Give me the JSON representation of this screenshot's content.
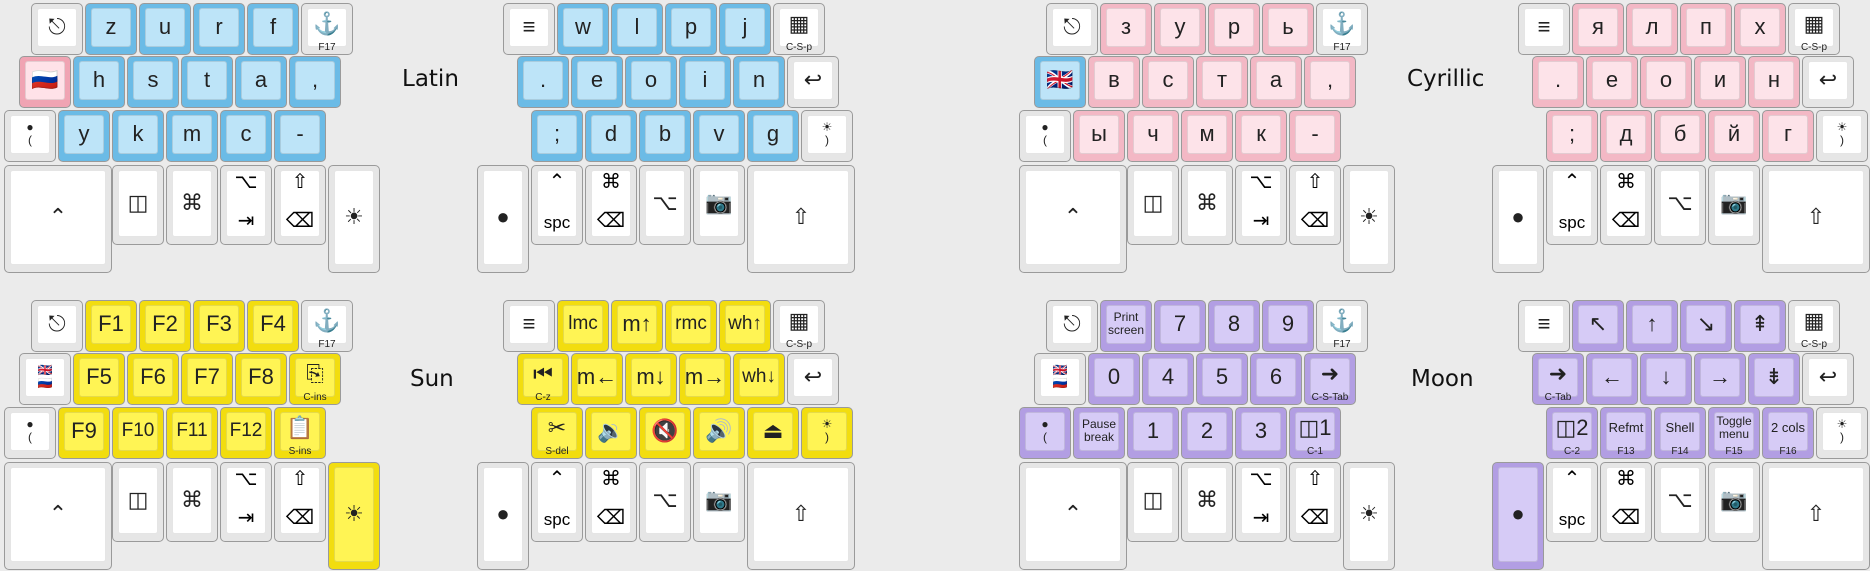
{
  "colors": {
    "blue": "#6bbbe6",
    "pink": "#f3b8c5",
    "yellow": "#f2dd0f",
    "purple": "#b29ee3",
    "white": "#e6e6e6"
  },
  "icon_legend": {
    "⎋": "escape",
    "⚓": "anchor",
    "≡": "menu",
    "▦": "app-switcher",
    "↩": "enter",
    "⌃": "control",
    "◫": "dual-panel",
    "⌘": "command",
    "⌥": "option",
    "⇥": "tab",
    "⇧": "shift",
    "⌫": "backspace",
    "☀": "sun",
    "●": "moon",
    "📷": "camera"
  },
  "layers": [
    {
      "name": "latin",
      "title": "Latin",
      "keys": [
        {
          "id": "0",
          "label": "⎋",
          "color": "white"
        },
        {
          "id": "1",
          "label": "z",
          "color": "blue"
        },
        {
          "id": "2",
          "label": "u",
          "color": "blue"
        },
        {
          "id": "3",
          "label": "r",
          "color": "blue"
        },
        {
          "id": "4",
          "label": "f",
          "color": "blue"
        },
        {
          "id": "5",
          "label": "⚓",
          "sub": "F17",
          "color": "white"
        },
        {
          "id": "6",
          "label": "🇷🇺",
          "color": "red"
        },
        {
          "id": "7",
          "label": "h",
          "color": "blue"
        },
        {
          "id": "8",
          "label": "s",
          "color": "blue"
        },
        {
          "id": "9",
          "label": "t",
          "color": "blue"
        },
        {
          "id": "10",
          "label": "a",
          "color": "blue"
        },
        {
          "id": "11",
          "label": ",",
          "color": "blue"
        },
        {
          "id": "12",
          "label": "●\n(",
          "color": "white"
        },
        {
          "id": "13",
          "label": "y",
          "color": "blue"
        },
        {
          "id": "14",
          "label": "k",
          "color": "blue"
        },
        {
          "id": "15",
          "label": "m",
          "color": "blue"
        },
        {
          "id": "16",
          "label": "c",
          "color": "blue"
        },
        {
          "id": "17",
          "label": "-",
          "color": "blue"
        },
        {
          "id": "18",
          "label": "⌃",
          "color": "white"
        },
        {
          "id": "19",
          "label": "◫",
          "color": "white"
        },
        {
          "id": "20",
          "label": "⌘",
          "color": "white"
        },
        {
          "id": "21",
          "tap": "⌥",
          "hold": "⇥",
          "color": "white"
        },
        {
          "id": "22",
          "tap": "⇧",
          "hold": "⌫",
          "color": "white"
        },
        {
          "id": "23",
          "label": "☀",
          "color": "white"
        },
        {
          "id": "24",
          "label": "≡",
          "color": "white"
        },
        {
          "id": "25",
          "label": "w",
          "color": "blue"
        },
        {
          "id": "26",
          "label": "l",
          "color": "blue"
        },
        {
          "id": "27",
          "label": "p",
          "color": "blue"
        },
        {
          "id": "28",
          "label": "j",
          "color": "blue"
        },
        {
          "id": "29",
          "label": "▦",
          "sub": "C-S-p",
          "color": "white"
        },
        {
          "id": "30",
          "label": ".",
          "color": "blue"
        },
        {
          "id": "31",
          "label": "e",
          "color": "blue"
        },
        {
          "id": "32",
          "label": "o",
          "color": "blue"
        },
        {
          "id": "33",
          "label": "i",
          "color": "blue"
        },
        {
          "id": "34",
          "label": "n",
          "color": "blue"
        },
        {
          "id": "35",
          "label": "↩",
          "color": "white"
        },
        {
          "id": "36",
          "label": ";",
          "color": "blue"
        },
        {
          "id": "37",
          "label": "d",
          "color": "blue"
        },
        {
          "id": "38",
          "label": "b",
          "color": "blue"
        },
        {
          "id": "39",
          "label": "v",
          "color": "blue"
        },
        {
          "id": "40",
          "label": "g",
          "color": "blue"
        },
        {
          "id": "41",
          "label": "☀\n)",
          "color": "white"
        },
        {
          "id": "42",
          "label": "●",
          "color": "white"
        },
        {
          "id": "43",
          "tap": "⌃",
          "hold": "spc",
          "color": "white"
        },
        {
          "id": "44",
          "tap": "⌘",
          "hold": "⌫",
          "color": "white"
        },
        {
          "id": "45",
          "label": "⌥",
          "color": "white"
        },
        {
          "id": "46",
          "label": "📷",
          "color": "white"
        },
        {
          "id": "47",
          "label": "⇧",
          "color": "white"
        }
      ]
    },
    {
      "name": "cyrillic",
      "title": "Cyrillic",
      "keys": [
        {
          "id": "0",
          "label": "⎋",
          "color": "white"
        },
        {
          "id": "1",
          "label": "з",
          "color": "pink"
        },
        {
          "id": "2",
          "label": "у",
          "color": "pink"
        },
        {
          "id": "3",
          "label": "р",
          "color": "pink"
        },
        {
          "id": "4",
          "label": "ь",
          "color": "pink"
        },
        {
          "id": "5",
          "label": "⚓",
          "sub": "F17",
          "color": "white"
        },
        {
          "id": "6",
          "label": "🇬🇧",
          "color": "blue"
        },
        {
          "id": "7",
          "label": "в",
          "color": "pink"
        },
        {
          "id": "8",
          "label": "с",
          "color": "pink"
        },
        {
          "id": "9",
          "label": "т",
          "color": "pink"
        },
        {
          "id": "10",
          "label": "а",
          "color": "pink"
        },
        {
          "id": "11",
          "label": ",",
          "color": "pink"
        },
        {
          "id": "12",
          "label": "●\n(",
          "color": "white"
        },
        {
          "id": "13",
          "label": "ы",
          "color": "pink"
        },
        {
          "id": "14",
          "label": "ч",
          "color": "pink"
        },
        {
          "id": "15",
          "label": "м",
          "color": "pink"
        },
        {
          "id": "16",
          "label": "к",
          "color": "pink"
        },
        {
          "id": "17",
          "label": "-",
          "color": "pink"
        },
        {
          "id": "18",
          "label": "⌃",
          "color": "white"
        },
        {
          "id": "19",
          "label": "◫",
          "color": "white"
        },
        {
          "id": "20",
          "label": "⌘",
          "color": "white"
        },
        {
          "id": "21",
          "tap": "⌥",
          "hold": "⇥",
          "color": "white"
        },
        {
          "id": "22",
          "tap": "⇧",
          "hold": "⌫",
          "color": "white"
        },
        {
          "id": "23",
          "label": "☀",
          "color": "white"
        },
        {
          "id": "24",
          "label": "≡",
          "color": "white"
        },
        {
          "id": "25",
          "label": "я",
          "color": "pink"
        },
        {
          "id": "26",
          "label": "л",
          "color": "pink"
        },
        {
          "id": "27",
          "label": "п",
          "color": "pink"
        },
        {
          "id": "28",
          "label": "х",
          "color": "pink"
        },
        {
          "id": "29",
          "label": "▦",
          "sub": "C-S-p",
          "color": "white"
        },
        {
          "id": "30",
          "label": ".",
          "color": "pink"
        },
        {
          "id": "31",
          "label": "е",
          "color": "pink"
        },
        {
          "id": "32",
          "label": "о",
          "color": "pink"
        },
        {
          "id": "33",
          "label": "и",
          "color": "pink"
        },
        {
          "id": "34",
          "label": "н",
          "color": "pink"
        },
        {
          "id": "35",
          "label": "↩",
          "color": "white"
        },
        {
          "id": "36",
          "label": ";",
          "color": "pink"
        },
        {
          "id": "37",
          "label": "д",
          "color": "pink"
        },
        {
          "id": "38",
          "label": "б",
          "color": "pink"
        },
        {
          "id": "39",
          "label": "й",
          "color": "pink"
        },
        {
          "id": "40",
          "label": "г",
          "color": "pink"
        },
        {
          "id": "41",
          "label": "☀\n)",
          "color": "white"
        },
        {
          "id": "42",
          "label": "●",
          "color": "white"
        },
        {
          "id": "43",
          "tap": "⌃",
          "hold": "spc",
          "color": "white"
        },
        {
          "id": "44",
          "tap": "⌘",
          "hold": "⌫",
          "color": "white"
        },
        {
          "id": "45",
          "label": "⌥",
          "color": "white"
        },
        {
          "id": "46",
          "label": "📷",
          "color": "white"
        },
        {
          "id": "47",
          "label": "⇧",
          "color": "white"
        }
      ]
    },
    {
      "name": "sun",
      "title": "Sun",
      "keys": [
        {
          "id": "0",
          "label": "⎋",
          "color": "white"
        },
        {
          "id": "1",
          "label": "F1",
          "color": "yellow"
        },
        {
          "id": "2",
          "label": "F2",
          "color": "yellow"
        },
        {
          "id": "3",
          "label": "F3",
          "color": "yellow"
        },
        {
          "id": "4",
          "label": "F4",
          "color": "yellow"
        },
        {
          "id": "5",
          "label": "⚓",
          "sub": "F17",
          "color": "white"
        },
        {
          "id": "6",
          "label": "🇬🇧\n🇷🇺",
          "color": "white"
        },
        {
          "id": "7",
          "label": "F5",
          "color": "yellow"
        },
        {
          "id": "8",
          "label": "F6",
          "color": "yellow"
        },
        {
          "id": "9",
          "label": "F7",
          "color": "yellow"
        },
        {
          "id": "10",
          "label": "F8",
          "color": "yellow"
        },
        {
          "id": "11",
          "label": "⎘",
          "sub": "C-ins",
          "color": "yellow"
        },
        {
          "id": "12",
          "label": "●\n(",
          "color": "white"
        },
        {
          "id": "13",
          "label": "F9",
          "color": "yellow"
        },
        {
          "id": "14",
          "label": "F10",
          "color": "yellow"
        },
        {
          "id": "15",
          "label": "F11",
          "color": "yellow"
        },
        {
          "id": "16",
          "label": "F12",
          "color": "yellow"
        },
        {
          "id": "17",
          "label": "📋",
          "sub": "S-ins",
          "color": "yellow"
        },
        {
          "id": "18",
          "label": "⌃",
          "color": "white"
        },
        {
          "id": "19",
          "label": "◫",
          "color": "white"
        },
        {
          "id": "20",
          "label": "⌘",
          "color": "white"
        },
        {
          "id": "21",
          "tap": "⌥",
          "hold": "⇥",
          "color": "white"
        },
        {
          "id": "22",
          "tap": "⇧",
          "hold": "⌫",
          "color": "white"
        },
        {
          "id": "23",
          "label": "☀",
          "color": "yellow"
        },
        {
          "id": "24",
          "label": "≡",
          "color": "white"
        },
        {
          "id": "25",
          "label": "lmc",
          "color": "yellow"
        },
        {
          "id": "26",
          "label": "m↑",
          "color": "yellow"
        },
        {
          "id": "27",
          "label": "rmc",
          "color": "yellow"
        },
        {
          "id": "28",
          "label": "wh↑",
          "color": "yellow"
        },
        {
          "id": "29",
          "label": "▦",
          "sub": "C-S-p",
          "color": "white"
        },
        {
          "id": "30",
          "label": "⏮",
          "sub": "C-z",
          "color": "yellow"
        },
        {
          "id": "31",
          "label": "m←",
          "color": "yellow"
        },
        {
          "id": "32",
          "label": "m↓",
          "color": "yellow"
        },
        {
          "id": "33",
          "label": "m→",
          "color": "yellow"
        },
        {
          "id": "34",
          "label": "wh↓",
          "color": "yellow"
        },
        {
          "id": "35",
          "label": "↩",
          "color": "white"
        },
        {
          "id": "36",
          "label": "✂",
          "sub": "S-del",
          "color": "yellow"
        },
        {
          "id": "37",
          "label": "🔉",
          "color": "yellow"
        },
        {
          "id": "38",
          "label": "🔇",
          "color": "yellow"
        },
        {
          "id": "39",
          "label": "🔊",
          "color": "yellow"
        },
        {
          "id": "40",
          "label": "⏏",
          "color": "yellow"
        },
        {
          "id": "41",
          "label": "☀\n)",
          "color": "yellow"
        },
        {
          "id": "42",
          "label": "●",
          "color": "white"
        },
        {
          "id": "43",
          "tap": "⌃",
          "hold": "spc",
          "color": "white"
        },
        {
          "id": "44",
          "tap": "⌘",
          "hold": "⌫",
          "color": "white"
        },
        {
          "id": "45",
          "label": "⌥",
          "color": "white"
        },
        {
          "id": "46",
          "label": "📷",
          "color": "white"
        },
        {
          "id": "47",
          "label": "⇧",
          "color": "white"
        }
      ]
    },
    {
      "name": "moon",
      "title": "Moon",
      "keys": [
        {
          "id": "0",
          "label": "⎋",
          "color": "white"
        },
        {
          "id": "1",
          "label": "Print\nscreen",
          "color": "purple"
        },
        {
          "id": "2",
          "label": "7",
          "color": "purple"
        },
        {
          "id": "3",
          "label": "8",
          "color": "purple"
        },
        {
          "id": "4",
          "label": "9",
          "color": "purple"
        },
        {
          "id": "5",
          "label": "⚓",
          "sub": "F17",
          "color": "white"
        },
        {
          "id": "6",
          "label": "🇬🇧\n🇷🇺",
          "color": "white"
        },
        {
          "id": "7",
          "label": "0",
          "color": "purple"
        },
        {
          "id": "8",
          "label": "4",
          "color": "purple"
        },
        {
          "id": "9",
          "label": "5",
          "color": "purple"
        },
        {
          "id": "10",
          "label": "6",
          "color": "purple"
        },
        {
          "id": "11",
          "label": "➜",
          "sub": "C-S-Tab",
          "color": "purple"
        },
        {
          "id": "12",
          "label": "●\n(",
          "color": "purple"
        },
        {
          "id": "13",
          "label": "Pause\nbreak",
          "color": "purple"
        },
        {
          "id": "14",
          "label": "1",
          "color": "purple"
        },
        {
          "id": "15",
          "label": "2",
          "color": "purple"
        },
        {
          "id": "16",
          "label": "3",
          "color": "purple"
        },
        {
          "id": "17",
          "label": "◫1",
          "sub": "C-1",
          "color": "purple"
        },
        {
          "id": "18",
          "label": "⌃",
          "color": "white"
        },
        {
          "id": "19",
          "label": "◫",
          "color": "white"
        },
        {
          "id": "20",
          "label": "⌘",
          "color": "white"
        },
        {
          "id": "21",
          "tap": "⌥",
          "hold": "⇥",
          "color": "white"
        },
        {
          "id": "22",
          "tap": "⇧",
          "hold": "⌫",
          "color": "white"
        },
        {
          "id": "23",
          "label": "☀",
          "color": "white"
        },
        {
          "id": "24",
          "label": "≡",
          "color": "white"
        },
        {
          "id": "25",
          "label": "↖",
          "color": "purple"
        },
        {
          "id": "26",
          "label": "↑",
          "color": "purple"
        },
        {
          "id": "27",
          "label": "↘",
          "color": "purple"
        },
        {
          "id": "28",
          "label": "⇞",
          "color": "purple"
        },
        {
          "id": "29",
          "label": "▦",
          "sub": "C-S-p",
          "color": "white"
        },
        {
          "id": "30",
          "label": "➜",
          "sub": "C-Tab",
          "color": "purple"
        },
        {
          "id": "31",
          "label": "←",
          "color": "purple"
        },
        {
          "id": "32",
          "label": "↓",
          "color": "purple"
        },
        {
          "id": "33",
          "label": "→",
          "color": "purple"
        },
        {
          "id": "34",
          "label": "⇟",
          "color": "purple"
        },
        {
          "id": "35",
          "label": "↩",
          "color": "white"
        },
        {
          "id": "36",
          "label": "◫2",
          "sub": "C-2",
          "color": "purple"
        },
        {
          "id": "37",
          "label": "Refmt",
          "sub": "F13",
          "color": "purple"
        },
        {
          "id": "38",
          "label": "Shell",
          "sub": "F14",
          "color": "purple"
        },
        {
          "id": "39",
          "label": "Toggle\nmenu",
          "sub": "F15",
          "color": "purple"
        },
        {
          "id": "40",
          "label": "2 cols",
          "sub": "F16",
          "color": "purple"
        },
        {
          "id": "41",
          "label": "☀\n)",
          "color": "white"
        },
        {
          "id": "42",
          "label": "●",
          "color": "purple"
        },
        {
          "id": "43",
          "tap": "⌃",
          "hold": "spc",
          "color": "white"
        },
        {
          "id": "44",
          "tap": "⌘",
          "hold": "⌫",
          "color": "white"
        },
        {
          "id": "45",
          "label": "⌥",
          "color": "white"
        },
        {
          "id": "46",
          "label": "📷",
          "color": "white"
        },
        {
          "id": "47",
          "label": "⇧",
          "color": "white"
        }
      ]
    }
  ]
}
